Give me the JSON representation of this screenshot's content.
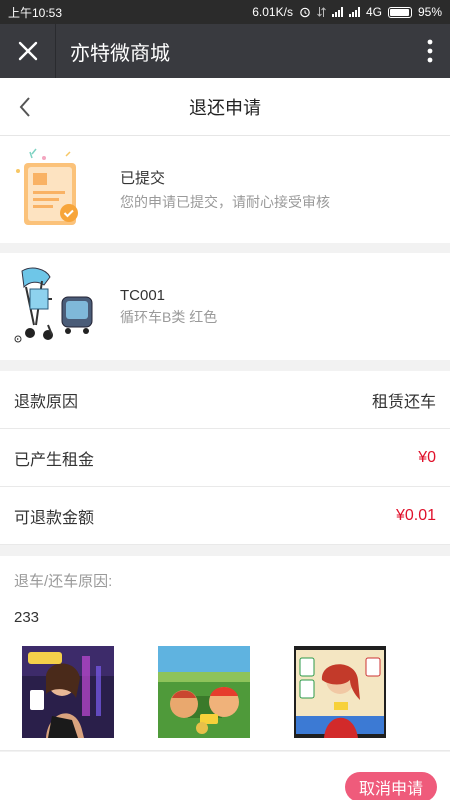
{
  "status_bar": {
    "time": "上午10:53",
    "speed": "6.01K/s",
    "network": "4G",
    "battery": "95%",
    "battery_level": 0.95
  },
  "title_bar": {
    "title": "亦特微商城",
    "close_icon": "close-icon",
    "more_icon": "more-vertical-icon"
  },
  "nav": {
    "title": "退还申请",
    "back_icon": "chevron-left-icon"
  },
  "status": {
    "title": "已提交",
    "subtitle": "您的申请已提交，请耐心接受审核",
    "icon": "document-check-icon"
  },
  "product": {
    "code": "TC001",
    "description": "循环车B类 红色"
  },
  "details": [
    {
      "label": "退款原因",
      "value": "租赁还车",
      "highlight": false
    },
    {
      "label": "已产生租金",
      "value": "¥0",
      "highlight": true
    },
    {
      "label": "可退款金额",
      "value": "¥0.01",
      "highlight": true
    }
  ],
  "reason": {
    "label": "退车/还车原因:",
    "content": "233"
  },
  "footer": {
    "cancel_label": "取消申请"
  },
  "colors": {
    "accent_red": "#e0112b",
    "button_pink": "#ef5b7b",
    "title_bar_bg": "#393a3f",
    "status_bar_bg": "#2b2b2b"
  }
}
